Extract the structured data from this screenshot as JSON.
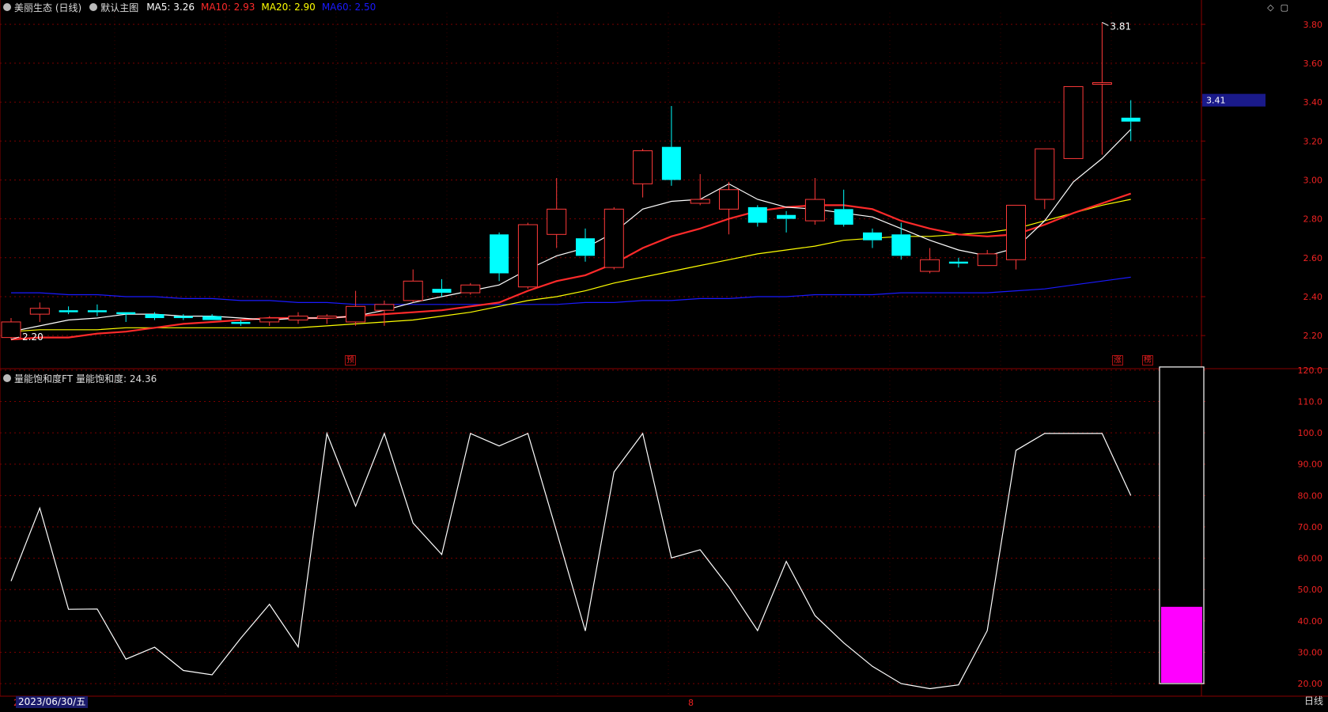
{
  "main_panel": {
    "stock_name": "美丽生态 (日线)",
    "template": "默认主图",
    "ma": [
      {
        "label": "MA5: 3.26",
        "color": "#ffffff"
      },
      {
        "label": "MA10: 2.93",
        "color": "#ff2a2a"
      },
      {
        "label": "MA20: 2.90",
        "color": "#ffff00"
      },
      {
        "label": "MA60: 2.50",
        "color": "#1a1aff"
      }
    ],
    "high_marker": "3.81",
    "low_marker": "2.20",
    "current_price": "3.41",
    "y_ticks": [
      "3.80",
      "3.60",
      "3.40",
      "3.20",
      "3.00",
      "2.80",
      "2.60",
      "2.40",
      "2.20"
    ],
    "event_tags": [
      "预",
      "涨",
      "榜"
    ]
  },
  "sub_panel": {
    "indicator": "量能饱和度FT",
    "value_label": "量能饱和度: 24.36",
    "y_ticks": [
      "120.0",
      "110.0",
      "100.0",
      "90.00",
      "80.00",
      "70.00",
      "60.00",
      "50.00",
      "40.00",
      "30.00",
      "20.00"
    ],
    "saturation_level": 44.5
  },
  "footer": {
    "date": "2023/06/30/五",
    "date_marker": "2",
    "month_marker": "8",
    "period": "日线"
  },
  "colors": {
    "up": "#ff3a3a",
    "down": "#00ffff",
    "grid": "#7a0000",
    "magenta": "#ff00ff"
  },
  "chart_data": {
    "type": "candlestick",
    "candles": [
      {
        "o": 2.19,
        "h": 2.29,
        "l": 2.18,
        "c": 2.27
      },
      {
        "o": 2.31,
        "h": 2.37,
        "l": 2.27,
        "c": 2.34
      },
      {
        "o": 2.33,
        "h": 2.35,
        "l": 2.31,
        "c": 2.32
      },
      {
        "o": 2.33,
        "h": 2.36,
        "l": 2.3,
        "c": 2.32
      },
      {
        "o": 2.32,
        "h": 2.32,
        "l": 2.27,
        "c": 2.31
      },
      {
        "o": 2.31,
        "h": 2.32,
        "l": 2.28,
        "c": 2.29
      },
      {
        "o": 2.3,
        "h": 2.31,
        "l": 2.28,
        "c": 2.29
      },
      {
        "o": 2.3,
        "h": 2.31,
        "l": 2.28,
        "c": 2.28
      },
      {
        "o": 2.27,
        "h": 2.28,
        "l": 2.25,
        "c": 2.26
      },
      {
        "o": 2.27,
        "h": 2.3,
        "l": 2.25,
        "c": 2.29
      },
      {
        "o": 2.28,
        "h": 2.32,
        "l": 2.26,
        "c": 2.3
      },
      {
        "o": 2.29,
        "h": 2.31,
        "l": 2.26,
        "c": 2.3
      },
      {
        "o": 2.27,
        "h": 2.43,
        "l": 2.25,
        "c": 2.35
      },
      {
        "o": 2.33,
        "h": 2.38,
        "l": 2.25,
        "c": 2.36
      },
      {
        "o": 2.38,
        "h": 2.54,
        "l": 2.37,
        "c": 2.48
      },
      {
        "o": 2.44,
        "h": 2.49,
        "l": 2.4,
        "c": 2.42
      },
      {
        "o": 2.42,
        "h": 2.47,
        "l": 2.41,
        "c": 2.46
      },
      {
        "o": 2.72,
        "h": 2.73,
        "l": 2.48,
        "c": 2.52
      },
      {
        "o": 2.45,
        "h": 2.78,
        "l": 2.44,
        "c": 2.77
      },
      {
        "o": 2.72,
        "h": 3.01,
        "l": 2.65,
        "c": 2.85
      },
      {
        "o": 2.7,
        "h": 2.75,
        "l": 2.58,
        "c": 2.61
      },
      {
        "o": 2.55,
        "h": 2.86,
        "l": 2.54,
        "c": 2.85
      },
      {
        "o": 2.98,
        "h": 3.16,
        "l": 2.91,
        "c": 3.15
      },
      {
        "o": 3.17,
        "h": 3.38,
        "l": 2.97,
        "c": 3.0
      },
      {
        "o": 2.88,
        "h": 3.03,
        "l": 2.87,
        "c": 2.9
      },
      {
        "o": 2.85,
        "h": 2.99,
        "l": 2.72,
        "c": 2.95
      },
      {
        "o": 2.86,
        "h": 2.87,
        "l": 2.76,
        "c": 2.78
      },
      {
        "o": 2.82,
        "h": 2.84,
        "l": 2.73,
        "c": 2.8
      },
      {
        "o": 2.79,
        "h": 3.01,
        "l": 2.77,
        "c": 2.9
      },
      {
        "o": 2.85,
        "h": 2.95,
        "l": 2.76,
        "c": 2.77
      },
      {
        "o": 2.73,
        "h": 2.75,
        "l": 2.65,
        "c": 2.69
      },
      {
        "o": 2.72,
        "h": 2.78,
        "l": 2.59,
        "c": 2.61
      },
      {
        "o": 2.53,
        "h": 2.65,
        "l": 2.52,
        "c": 2.59
      },
      {
        "o": 2.58,
        "h": 2.6,
        "l": 2.55,
        "c": 2.57
      },
      {
        "o": 2.56,
        "h": 2.64,
        "l": 2.56,
        "c": 2.62
      },
      {
        "o": 2.59,
        "h": 2.87,
        "l": 2.54,
        "c": 2.87
      },
      {
        "o": 2.9,
        "h": 3.16,
        "l": 2.85,
        "c": 3.16
      },
      {
        "o": 3.11,
        "h": 3.48,
        "l": 3.11,
        "c": 3.48
      },
      {
        "o": 3.5,
        "h": 3.81,
        "l": 3.13,
        "c": 3.5
      },
      {
        "o": 3.32,
        "h": 3.41,
        "l": 3.2,
        "c": 3.3
      }
    ],
    "ma5": [
      2.22,
      2.25,
      2.28,
      2.29,
      2.31,
      2.31,
      2.3,
      2.3,
      2.29,
      2.28,
      2.29,
      2.29,
      2.3,
      2.33,
      2.37,
      2.4,
      2.43,
      2.46,
      2.54,
      2.61,
      2.65,
      2.73,
      2.85,
      2.89,
      2.9,
      2.98,
      2.9,
      2.86,
      2.85,
      2.83,
      2.81,
      2.75,
      2.69,
      2.64,
      2.61,
      2.65,
      2.79,
      2.99,
      3.11,
      3.26
    ],
    "ma10": [
      2.18,
      2.19,
      2.19,
      2.21,
      2.22,
      2.24,
      2.26,
      2.27,
      2.28,
      2.29,
      2.29,
      2.29,
      2.3,
      2.31,
      2.32,
      2.33,
      2.35,
      2.37,
      2.43,
      2.48,
      2.51,
      2.57,
      2.65,
      2.71,
      2.75,
      2.8,
      2.84,
      2.86,
      2.87,
      2.87,
      2.85,
      2.79,
      2.75,
      2.72,
      2.71,
      2.72,
      2.77,
      2.83,
      2.88,
      2.93
    ],
    "ma20": [
      2.22,
      2.23,
      2.23,
      2.23,
      2.24,
      2.24,
      2.24,
      2.24,
      2.24,
      2.24,
      2.24,
      2.25,
      2.26,
      2.27,
      2.28,
      2.3,
      2.32,
      2.35,
      2.38,
      2.4,
      2.43,
      2.47,
      2.5,
      2.53,
      2.56,
      2.59,
      2.62,
      2.64,
      2.66,
      2.69,
      2.7,
      2.71,
      2.71,
      2.72,
      2.73,
      2.75,
      2.79,
      2.83,
      2.87,
      2.9
    ],
    "ma60": [
      2.42,
      2.42,
      2.41,
      2.41,
      2.4,
      2.4,
      2.39,
      2.39,
      2.38,
      2.38,
      2.37,
      2.37,
      2.36,
      2.36,
      2.36,
      2.36,
      2.36,
      2.36,
      2.36,
      2.36,
      2.37,
      2.37,
      2.38,
      2.38,
      2.39,
      2.39,
      2.4,
      2.4,
      2.41,
      2.41,
      2.41,
      2.42,
      2.42,
      2.42,
      2.42,
      2.43,
      2.44,
      2.46,
      2.48,
      2.5
    ],
    "saturation": [
      52.7,
      76,
      43.7,
      43.8,
      27.8,
      31.6,
      24.2,
      22.8,
      34.5,
      45.3,
      31.7,
      99.8,
      76.6,
      99.8,
      71.2,
      61.2,
      99.8,
      95.8,
      99.8,
      68.5,
      36.8,
      87.5,
      99.8,
      60.1,
      62.7,
      50.8,
      36.9,
      59,
      41.7,
      33,
      25.5,
      20,
      18.4,
      19.6,
      36.9,
      94.4,
      99.8,
      99.8,
      99.8,
      80
    ],
    "y_range_main": [
      2.16,
      3.86
    ],
    "y_range_sub": [
      17,
      124
    ]
  }
}
